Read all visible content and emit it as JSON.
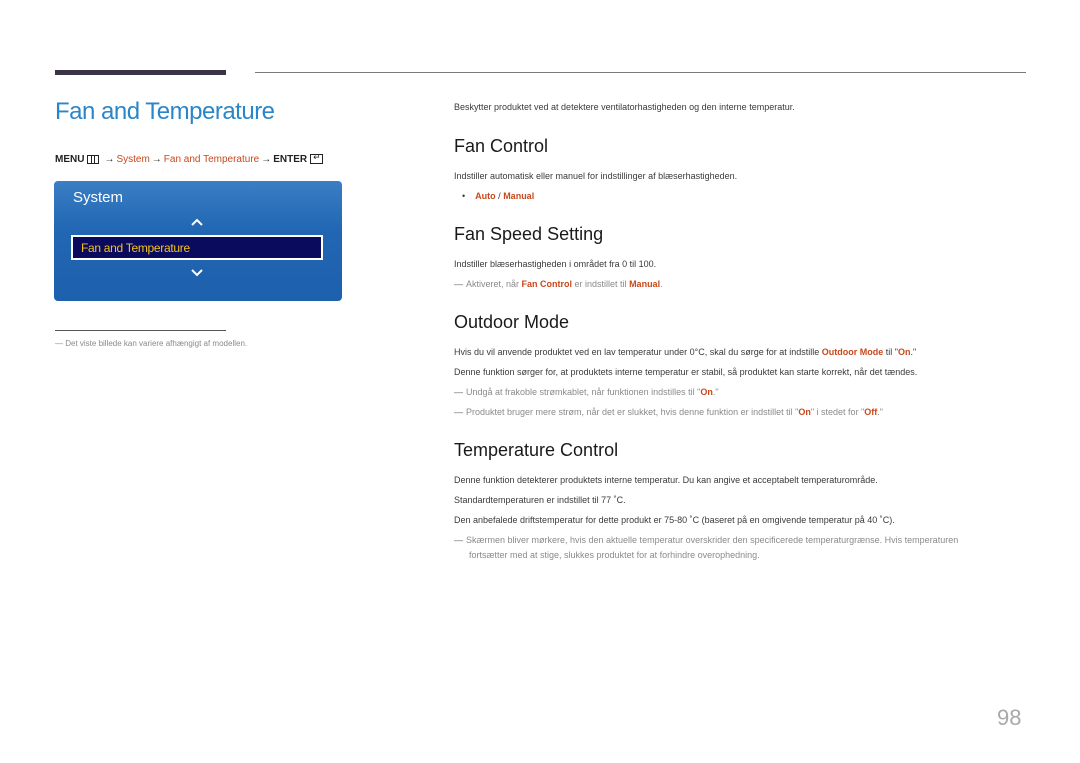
{
  "header": {
    "title": "Fan and Temperature"
  },
  "menu_path": {
    "menu": "MENU",
    "arrow": "→",
    "system": "System",
    "item": "Fan and Temperature",
    "enter": "ENTER"
  },
  "osd": {
    "title": "System",
    "selected_item": "Fan and Temperature",
    "colors": {
      "panel": "#1d60ad",
      "selected_bg": "#0b0b5e",
      "selected_text": "#f4c21a"
    }
  },
  "left_note": "Det viste billede kan variere afhængigt af modellen.",
  "intro": "Beskytter produktet ved at detektere ventilatorhastigheden og den interne temperatur.",
  "sections": {
    "fan_control": {
      "title": "Fan Control",
      "desc": "Indstiller automatisk eller manuel for indstillinger af blæserhastigheden.",
      "option_auto": "Auto",
      "option_sep": " / ",
      "option_manual": "Manual"
    },
    "fan_speed": {
      "title": "Fan Speed Setting",
      "desc": "Indstiller blæserhastigheden i området fra 0 til 100.",
      "note_pre": "Aktiveret, når ",
      "note_hl1": "Fan Control",
      "note_mid": " er indstillet til ",
      "note_hl2": "Manual",
      "note_post": "."
    },
    "outdoor": {
      "title": "Outdoor Mode",
      "p1_pre": "Hvis du vil anvende produktet ved en lav temperatur under 0°C, skal du sørge for at indstille ",
      "p1_hl1": "Outdoor Mode",
      "p1_mid": " til \"",
      "p1_hl2": "On",
      "p1_post": ".\"",
      "p2": "Denne funktion sørger for, at produktets interne temperatur er stabil, så produktet kan starte korrekt, når det tændes.",
      "n1_pre": "Undgå at frakoble strømkablet, når funktionen indstilles til \"",
      "n1_hl": "On",
      "n1_post": ".\"",
      "n2_pre": "Produktet bruger mere strøm, når det er slukket, hvis denne funktion er indstillet til \"",
      "n2_hl1": "On",
      "n2_mid": "\" i stedet for \"",
      "n2_hl2": "Off",
      "n2_post": ".\""
    },
    "temp_control": {
      "title": "Temperature Control",
      "p1": "Denne funktion detekterer produktets interne temperatur. Du kan angive et acceptabelt temperaturområde.",
      "p2": "Standardtemperaturen er indstillet til 77 ˚C.",
      "p3": "Den anbefalede driftstemperatur for dette produkt er 75-80 ˚C (baseret på en omgivende temperatur på 40 ˚C).",
      "note_l1": "Skærmen bliver mørkere, hvis den aktuelle temperatur overskrider den specificerede temperaturgrænse. Hvis temperaturen",
      "note_l2": "fortsætter med at stige, slukkes produktet for at forhindre overophedning."
    }
  },
  "page_number": "98",
  "note_dash": "—",
  "bullet": "•"
}
